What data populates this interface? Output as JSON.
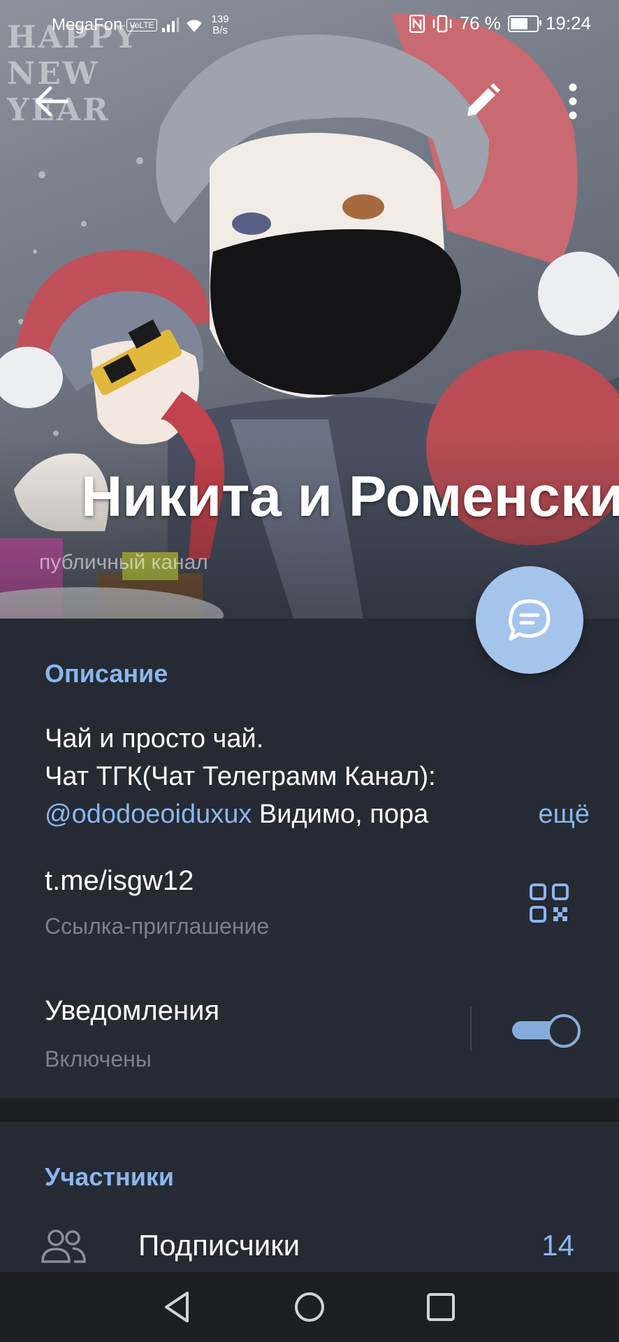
{
  "status_bar": {
    "carrier": "MegaFon",
    "volte": "VoLTE",
    "speed_value": "139",
    "speed_unit": "B/s",
    "battery_percent": "76 %",
    "battery_level": 0.76,
    "time": "19:24"
  },
  "header_image": {
    "overlay_text": "HAPPY\nNEW\nYEAR"
  },
  "channel": {
    "title": "Никита и Роменский",
    "subtitle": "публичный канал"
  },
  "description": {
    "heading": "Описание",
    "line1": "Чай и просто чай.",
    "line2": "Чат ТГК(Чат Телеграмм Канал):",
    "mention": "@ododoeoiduxux",
    "line3_rest": " Видимо, пора",
    "more": "ещё"
  },
  "invite": {
    "link": "t.me/isgw12",
    "label": "Ссылка-приглашение"
  },
  "notifications": {
    "label": "Уведомления",
    "status": "Включены",
    "enabled": true
  },
  "members": {
    "heading": "Участники",
    "subscribers_label": "Подписчики",
    "subscribers_count": "14"
  },
  "icons": {
    "back": "arrow-left-icon",
    "edit": "pencil-icon",
    "menu": "more-vertical-icon",
    "fab": "chat-bubble-icon",
    "qr": "qr-code-icon",
    "people": "people-icon"
  },
  "colors": {
    "accent": "#8ab6ef",
    "fab": "#a5c4ec",
    "surface": "#262a33",
    "background": "#1f232b"
  }
}
